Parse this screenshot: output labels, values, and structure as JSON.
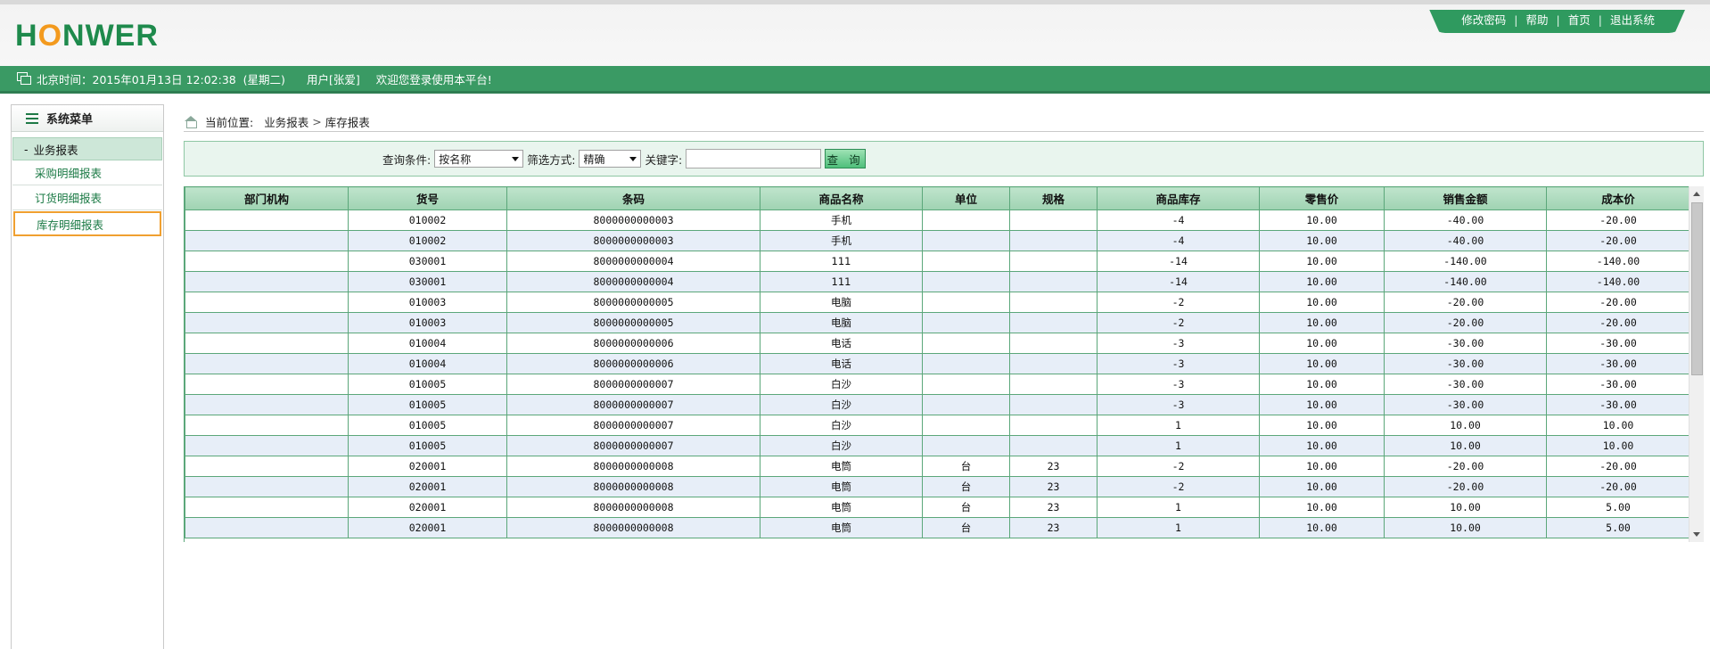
{
  "header": {
    "logo_pre": "H",
    "logo_o": "O",
    "logo_post": "NWER",
    "links": [
      "修改密码",
      "帮助",
      "首页",
      "退出系统"
    ],
    "separator": "|"
  },
  "status": {
    "time_label": "北京时间：2015年01月13日 12:02:38  (星期二)",
    "user": "用户[张爱]",
    "welcome": "欢迎您登录使用本平台!"
  },
  "sidebar": {
    "title": "系统菜单",
    "group": "业务报表",
    "group_toggle": "-",
    "items": [
      "采购明细报表",
      "订货明细报表",
      "库存明细报表"
    ]
  },
  "breadcrumb": {
    "label": "当前位置:",
    "path1": "业务报表",
    "sep": ">",
    "path2": "库存报表"
  },
  "search": {
    "cond_label": "查询条件:",
    "cond_value": "按名称",
    "mode_label": "筛选方式:",
    "mode_value": "精确",
    "keyword_label": "关键字:",
    "keyword_value": "",
    "button": "查 询"
  },
  "table": {
    "columns": [
      "部门机构",
      "货号",
      "条码",
      "商品名称",
      "单位",
      "规格",
      "商品库存",
      "零售价",
      "销售金额",
      "成本价"
    ],
    "rows": [
      [
        "",
        "010002",
        "8000000000003",
        "手机",
        "",
        "",
        "-4",
        "10.00",
        "-40.00",
        "-20.00"
      ],
      [
        "",
        "010002",
        "8000000000003",
        "手机",
        "",
        "",
        "-4",
        "10.00",
        "-40.00",
        "-20.00"
      ],
      [
        "",
        "030001",
        "8000000000004",
        "111",
        "",
        "",
        "-14",
        "10.00",
        "-140.00",
        "-140.00"
      ],
      [
        "",
        "030001",
        "8000000000004",
        "111",
        "",
        "",
        "-14",
        "10.00",
        "-140.00",
        "-140.00"
      ],
      [
        "",
        "010003",
        "8000000000005",
        "电脑",
        "",
        "",
        "-2",
        "10.00",
        "-20.00",
        "-20.00"
      ],
      [
        "",
        "010003",
        "8000000000005",
        "电脑",
        "",
        "",
        "-2",
        "10.00",
        "-20.00",
        "-20.00"
      ],
      [
        "",
        "010004",
        "8000000000006",
        "电话",
        "",
        "",
        "-3",
        "10.00",
        "-30.00",
        "-30.00"
      ],
      [
        "",
        "010004",
        "8000000000006",
        "电话",
        "",
        "",
        "-3",
        "10.00",
        "-30.00",
        "-30.00"
      ],
      [
        "",
        "010005",
        "8000000000007",
        "白沙",
        "",
        "",
        "-3",
        "10.00",
        "-30.00",
        "-30.00"
      ],
      [
        "",
        "010005",
        "8000000000007",
        "白沙",
        "",
        "",
        "-3",
        "10.00",
        "-30.00",
        "-30.00"
      ],
      [
        "",
        "010005",
        "8000000000007",
        "白沙",
        "",
        "",
        "1",
        "10.00",
        "10.00",
        "10.00"
      ],
      [
        "",
        "010005",
        "8000000000007",
        "白沙",
        "",
        "",
        "1",
        "10.00",
        "10.00",
        "10.00"
      ],
      [
        "",
        "020001",
        "8000000000008",
        "电筒",
        "台",
        "23",
        "-2",
        "10.00",
        "-20.00",
        "-20.00"
      ],
      [
        "",
        "020001",
        "8000000000008",
        "电筒",
        "台",
        "23",
        "-2",
        "10.00",
        "-20.00",
        "-20.00"
      ],
      [
        "",
        "020001",
        "8000000000008",
        "电筒",
        "台",
        "23",
        "1",
        "10.00",
        "10.00",
        "5.00"
      ],
      [
        "",
        "020001",
        "8000000000008",
        "电筒",
        "台",
        "23",
        "1",
        "10.00",
        "10.00",
        "5.00"
      ]
    ]
  },
  "colors": {
    "brand_green": "#3a9a64",
    "logo_orange": "#f39a1e",
    "header_bg": "#bfe4cc",
    "row_alt": "#e7eef8",
    "active_border": "#f0a030"
  }
}
